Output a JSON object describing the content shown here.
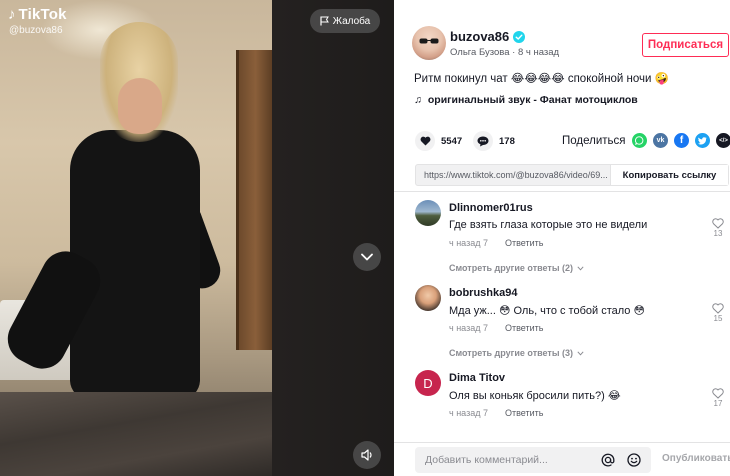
{
  "video": {
    "logo_text": "TikTok",
    "username": "@buzova86",
    "report_label": "Жалоба"
  },
  "author": {
    "username": "buzova86",
    "display_name": "Ольга Бузова",
    "separator": "·",
    "time_ago": "8 ч назад",
    "follow_label": "Подписаться"
  },
  "post": {
    "description": "Ритм покинул чат 😂😂😂😂 спокойной ночи 🤪",
    "music": "оригинальный звук - Фанат мотоциклов"
  },
  "stats": {
    "likes": "5547",
    "comments": "178",
    "share_label": "Поделиться"
  },
  "share_icons": [
    "whatsapp-icon",
    "vk-icon",
    "facebook-icon",
    "twitter-icon",
    "embed-icon"
  ],
  "link": {
    "url": "https://www.tiktok.com/@buzova86/video/69...",
    "copy_label": "Копировать ссылку"
  },
  "comments": [
    {
      "username": "Dlinnomer01rus",
      "text": "Где взять глаза которые это не видели",
      "time": "ч назад 7",
      "reply_label": "Ответить",
      "likes": "13",
      "more_replies": "Смотреть другие ответы (2)"
    },
    {
      "username": "bobrushka94",
      "text": "Мда уж... 😳 Оль, что с тобой стало 😳",
      "time": "ч назад 7",
      "reply_label": "Ответить",
      "likes": "15",
      "more_replies": "Смотреть другие ответы (3)"
    },
    {
      "username": "Dima Titov",
      "avatar_letter": "D",
      "text": "Оля вы коньяк бросили пить?) 😂",
      "time": "ч назад 7",
      "reply_label": "Ответить",
      "likes": "17"
    }
  ],
  "comment_bar": {
    "placeholder": "Добавить комментарий...",
    "post_label": "Опубликовать"
  },
  "colors": {
    "accent": "#fe2c55",
    "verified": "#20d5ec",
    "whatsapp": "#25d366",
    "vk": "#4c75a3",
    "facebook": "#1877f2",
    "twitter": "#1da1f2",
    "dima_avatar": "#c7254e"
  }
}
